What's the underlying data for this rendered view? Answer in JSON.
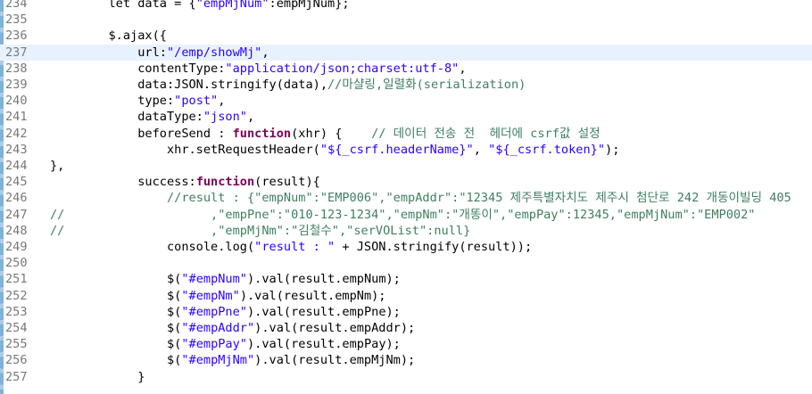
{
  "editor": {
    "current_line": 237,
    "lines": [
      {
        "n": "234",
        "tokens": [
          {
            "t": "        let data = {"
          },
          {
            "t": "\"empMjNum\"",
            "c": "str"
          },
          {
            "t": ":empMjNum};"
          }
        ]
      },
      {
        "n": "235",
        "tokens": []
      },
      {
        "n": "236",
        "tokens": [
          {
            "t": "        $.ajax({"
          }
        ]
      },
      {
        "n": "237",
        "tokens": [
          {
            "t": "            url:"
          },
          {
            "t": "\"/emp/showMj\"",
            "c": "str"
          },
          {
            "t": ","
          }
        ]
      },
      {
        "n": "238",
        "tokens": [
          {
            "t": "            contentType:"
          },
          {
            "t": "\"application/json;charset:utf-8\"",
            "c": "str"
          },
          {
            "t": ","
          }
        ]
      },
      {
        "n": "239",
        "tokens": [
          {
            "t": "            data:JSON.stringify(data),"
          },
          {
            "t": "//마샬링,일렬화(serialization)",
            "c": "cmt"
          }
        ]
      },
      {
        "n": "240",
        "tokens": [
          {
            "t": "            type:"
          },
          {
            "t": "\"post\"",
            "c": "str"
          },
          {
            "t": ","
          }
        ]
      },
      {
        "n": "241",
        "tokens": [
          {
            "t": "            dataType:"
          },
          {
            "t": "\"json\"",
            "c": "str"
          },
          {
            "t": ","
          }
        ]
      },
      {
        "n": "242",
        "tokens": [
          {
            "t": "            beforeSend : "
          },
          {
            "t": "function",
            "c": "kw"
          },
          {
            "t": "(xhr) {    "
          },
          {
            "t": "// 데이터 전송 전  헤더에 csrf값 설정",
            "c": "cmt"
          }
        ]
      },
      {
        "n": "243",
        "tokens": [
          {
            "t": "                xhr.setRequestHeader("
          },
          {
            "t": "\"${_csrf.headerName}\"",
            "c": "str"
          },
          {
            "t": ", "
          },
          {
            "t": "\"${_csrf.token}\"",
            "c": "str"
          },
          {
            "t": ");"
          }
        ]
      },
      {
        "n": "244",
        "tokens": [
          {
            "t": "},"
          }
        ]
      },
      {
        "n": "245",
        "tokens": [
          {
            "t": "            success:"
          },
          {
            "t": "function",
            "c": "kw"
          },
          {
            "t": "(result){"
          }
        ]
      },
      {
        "n": "246",
        "tokens": [
          {
            "t": "                "
          },
          {
            "t": "//result : {\"empNum\":\"EMP006\",\"empAddr\":\"12345 제주특별자치도 제주시 첨단로 242 개동이빌딩 405",
            "c": "cmt"
          }
        ]
      },
      {
        "n": "247",
        "tokens": [
          {
            "t": "//",
            "c": "cmt"
          },
          {
            "t": "                    ,\"empPne\":\"010-123-1234\",\"empNm\":\"개똥이\",\"empPay\":12345,\"empMjNum\":\"EMP002\"",
            "c": "cmt"
          }
        ]
      },
      {
        "n": "248",
        "tokens": [
          {
            "t": "//",
            "c": "cmt"
          },
          {
            "t": "                    ,\"empMjNm\":\"김철수\",\"serVOList\":null}",
            "c": "cmt"
          }
        ]
      },
      {
        "n": "249",
        "tokens": [
          {
            "t": "                console.log("
          },
          {
            "t": "\"result : \"",
            "c": "str"
          },
          {
            "t": " + JSON.stringify(result));"
          }
        ]
      },
      {
        "n": "250",
        "tokens": []
      },
      {
        "n": "251",
        "tokens": [
          {
            "t": "                $("
          },
          {
            "t": "\"#empNum\"",
            "c": "str"
          },
          {
            "t": ").val(result.empNum);"
          }
        ]
      },
      {
        "n": "252",
        "tokens": [
          {
            "t": "                $("
          },
          {
            "t": "\"#empNm\"",
            "c": "str"
          },
          {
            "t": ").val(result.empNm);"
          }
        ]
      },
      {
        "n": "253",
        "tokens": [
          {
            "t": "                $("
          },
          {
            "t": "\"#empPne\"",
            "c": "str"
          },
          {
            "t": ").val(result.empPne);"
          }
        ]
      },
      {
        "n": "254",
        "tokens": [
          {
            "t": "                $("
          },
          {
            "t": "\"#empAddr\"",
            "c": "str"
          },
          {
            "t": ").val(result.empAddr);"
          }
        ]
      },
      {
        "n": "255",
        "tokens": [
          {
            "t": "                $("
          },
          {
            "t": "\"#empPay\"",
            "c": "str"
          },
          {
            "t": ").val(result.empPay);"
          }
        ]
      },
      {
        "n": "256",
        "tokens": [
          {
            "t": "                $("
          },
          {
            "t": "\"#empMjNm\"",
            "c": "str"
          },
          {
            "t": ").val(result.empMjNm);"
          }
        ]
      },
      {
        "n": "257",
        "tokens": [
          {
            "t": "            }"
          }
        ]
      }
    ],
    "colors": {
      "keyword": "#7f0055",
      "string": "#2a00ff",
      "comment": "#3f7f5f",
      "line_number": "#787878",
      "current_line_bg": "#e8f2fe"
    }
  }
}
